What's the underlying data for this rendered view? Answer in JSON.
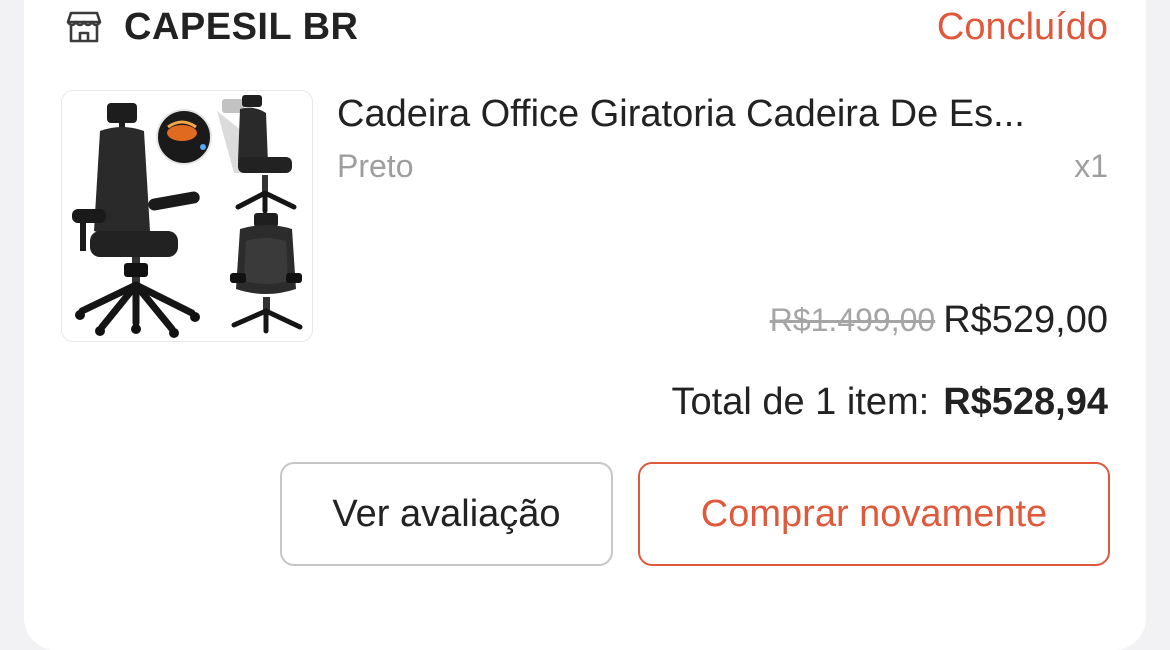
{
  "shop": {
    "icon": "storefront-icon",
    "name": "CAPESIL BR",
    "status": "Concluído"
  },
  "product": {
    "image_icon": "office-chair-photo",
    "title": "Cadeira Office Giratoria Cadeira De Es...",
    "variant": "Preto",
    "quantity": "x1",
    "original_price": "R$1.499,00",
    "current_price": "R$529,00"
  },
  "summary": {
    "total_label": "Total de 1 item:",
    "total_amount": "R$528,94"
  },
  "actions": {
    "review_label": "Ver avaliação",
    "buy_again_label": "Comprar novamente"
  },
  "colors": {
    "accent": "#e0583b",
    "text": "#222222",
    "muted": "#9e9e9e",
    "border": "#c6c6c6",
    "background": "#f2f2f4"
  }
}
